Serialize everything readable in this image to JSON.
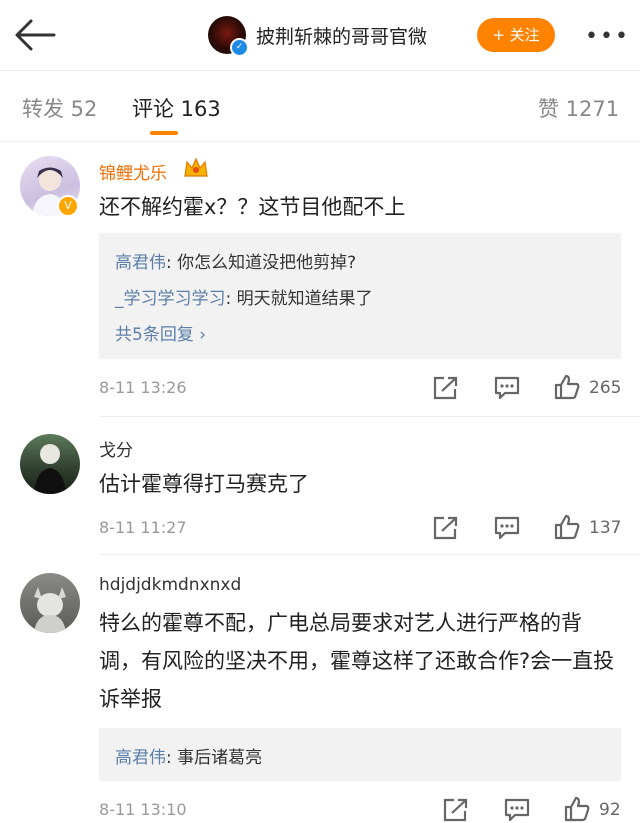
{
  "header": {
    "title": "披荆斩棘的哥哥官微",
    "follow_label": "+ 关注",
    "more_label": "•••"
  },
  "tabs": {
    "reposts": "转发 52",
    "comments": "评论 163",
    "likes": "赞 1271"
  },
  "comments": [
    {
      "user": "锦鲤尤乐",
      "text": "还不解约霍x？？这节目他配不上",
      "replies": [
        {
          "who": "高君伟",
          "text": ": 你怎么知道没把他剪掉?"
        },
        {
          "who": "_学习学习学习",
          "text": ": 明天就知道结果了"
        }
      ],
      "more_replies": "共5条回复 ›",
      "time": "8-11 13:26",
      "likes": "265"
    },
    {
      "user": "戈分",
      "text": "估计霍尊得打马赛克了",
      "time": "8-11 11:27",
      "likes": "137"
    },
    {
      "user": "hdjdjdkmdnxnxd",
      "text": "特么的霍尊不配，广电总局要求对艺人进行严格的背调，有风险的坚决不用，霍尊这样了还敢合作?会一直投诉举报",
      "replies": [
        {
          "who": "高君伟",
          "text": ": 事后诸葛亮"
        }
      ],
      "time": "8-11 13:10",
      "likes": "92"
    }
  ],
  "colors": {
    "accent": "#ff8200",
    "vip_name": "#f86c00",
    "reply_link": "#5b7fa8"
  }
}
